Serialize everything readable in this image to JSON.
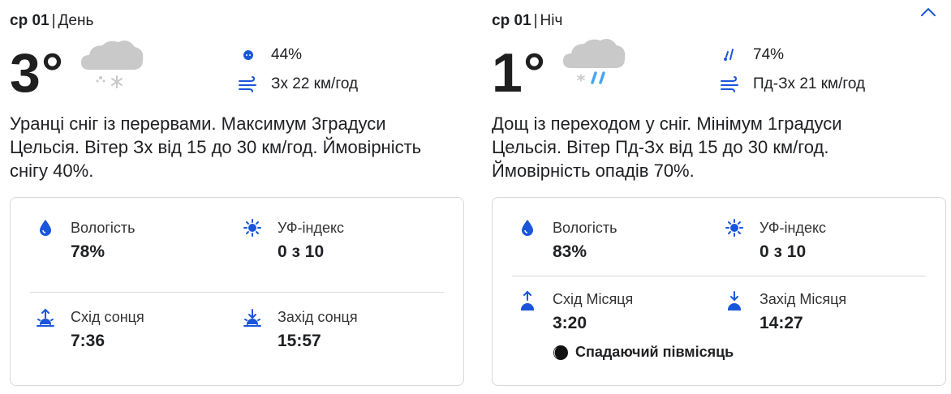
{
  "day": {
    "date": "ср 01",
    "period": "День",
    "temperature": "3°",
    "weather_icon": "cloud-snow-icon",
    "stat1": {
      "icon": "precipitation-dot-icon",
      "value": "44%"
    },
    "stat2": {
      "icon": "wind-icon",
      "value": "Зх 22 км/год"
    },
    "description": "Уранці сніг із перервами. Максимум 3градуси Цельсія. Вітер Зх від 15 до 30 км/год. Ймовірність снігу 40%.",
    "details": {
      "humidity": {
        "label": "Вологість",
        "value": "78%"
      },
      "uv": {
        "label": "УФ-індекс",
        "value": "0 з 10"
      },
      "rise": {
        "label": "Схід сонця",
        "value": "7:36"
      },
      "set": {
        "label": "Захід сонця",
        "value": "15:57"
      }
    }
  },
  "night": {
    "date": "ср 01",
    "period": "Ніч",
    "temperature": "1°",
    "weather_icon": "cloud-rain-snow-icon",
    "stat1": {
      "icon": "rain-drops-icon",
      "value": "74%"
    },
    "stat2": {
      "icon": "wind-icon",
      "value": "Пд-Зх 21 км/год"
    },
    "description": "Дощ із переходом у сніг. Мінімум 1градуси Цельсія. Вітер Пд-Зх від 15 до 30 км/год. Ймовірність опадів 70%.",
    "details": {
      "humidity": {
        "label": "Вологість",
        "value": "83%"
      },
      "uv": {
        "label": "УФ-індекс",
        "value": "0 з 10"
      },
      "rise": {
        "label": "Схід Місяця",
        "value": "3:20"
      },
      "set": {
        "label": "Захід Місяця",
        "value": "14:27"
      },
      "moon_phase": "Спадаючий півмісяць"
    }
  },
  "colors": {
    "accent": "#1a56db",
    "cloud": "#c9c9c9",
    "rain": "#4aa3f0",
    "text": "#202124",
    "border": "#d8d8d8"
  }
}
